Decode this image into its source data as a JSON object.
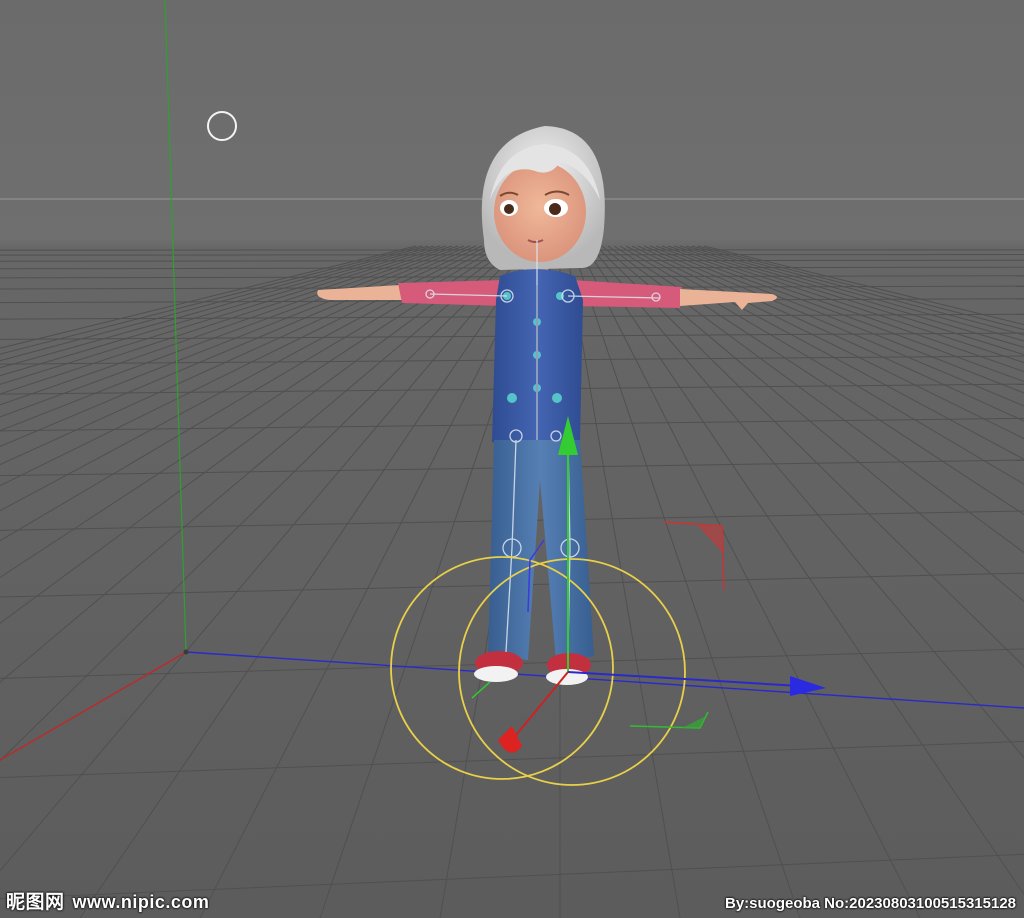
{
  "viewport": {
    "background_top": "#6c6c6c",
    "background_bottom": "#5a5a5a",
    "grid_color": "#555555",
    "axis_colors": {
      "x": "#2222cc",
      "y": "#22aa22",
      "z": "#cc2222"
    },
    "gizmo_ring_color": "#e8d04a"
  },
  "character": {
    "hair_color": "#d6d6d6",
    "skin_color": "#e8a98a",
    "shirt_color": "#d65a7a",
    "vest_color": "#3a5aa8",
    "jeans_color": "#4a72a8",
    "shoe_color": "#c23040"
  },
  "watermark": {
    "site_name": "昵图网",
    "site_url": "www.nipic.com",
    "credit": "By:suogeoba No:20230803100515315128"
  }
}
